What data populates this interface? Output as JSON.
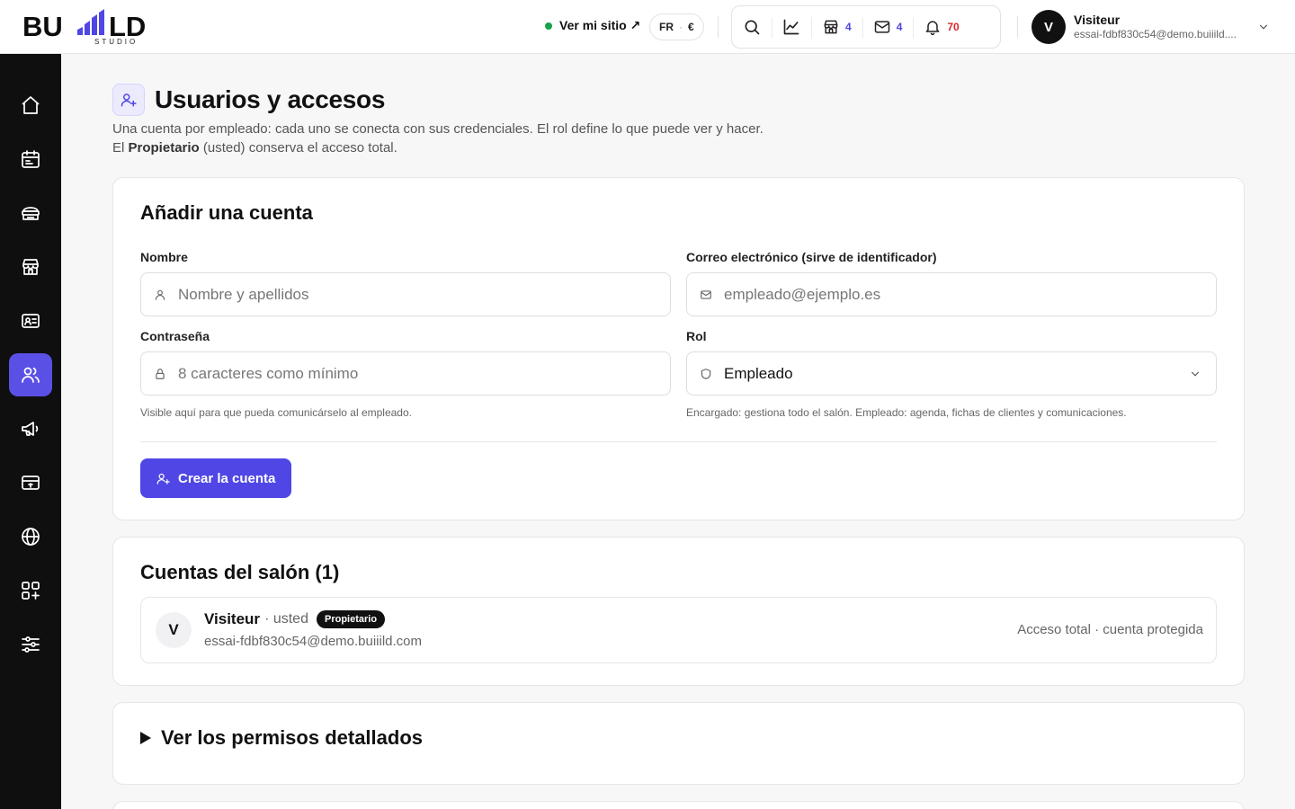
{
  "header": {
    "logo_text": "BUILD",
    "logo_sub": "STUDIO",
    "site_link": "Ver mi sitio ↗",
    "lang": "FR",
    "currency": "€",
    "badges": {
      "store": "4",
      "mail": "4",
      "bell": "70"
    },
    "user": {
      "initial": "V",
      "name": "Visiteur",
      "email": "essai-fdbf830c54@demo.buiiild...."
    }
  },
  "sidebar": {
    "items": [
      {
        "icon": "home-icon"
      },
      {
        "icon": "calendar-icon"
      },
      {
        "icon": "services-icon"
      },
      {
        "icon": "store-icon"
      },
      {
        "icon": "id-card-icon"
      },
      {
        "icon": "users-icon",
        "active": true
      },
      {
        "icon": "megaphone-icon"
      },
      {
        "icon": "payment-icon"
      },
      {
        "icon": "globe-icon"
      },
      {
        "icon": "apps-icon"
      },
      {
        "icon": "sliders-icon"
      }
    ]
  },
  "page": {
    "title": "Usuarios y accesos",
    "desc_part1": "Una cuenta por empleado: cada uno se conecta con sus credenciales. El rol define lo que puede ver y hacer. El ",
    "desc_bold": "Propietario",
    "desc_part2": " (usted) conserva el acceso total."
  },
  "add_account": {
    "title": "Añadir una cuenta",
    "name_label": "Nombre",
    "name_placeholder": "Nombre y apellidos",
    "email_label": "Correo electrónico (sirve de identificador)",
    "email_placeholder": "empleado@ejemplo.es",
    "password_label": "Contraseña",
    "password_placeholder": "8 caracteres como mínimo",
    "password_hint": "Visible aquí para que pueda comunicárselo al empleado.",
    "role_label": "Rol",
    "role_value": "Empleado",
    "role_hint": "Encargado: gestiona todo el salón. Empleado: agenda, fichas de clientes y comunicaciones.",
    "submit_label": "Crear la cuenta"
  },
  "accounts": {
    "title": "Cuentas del salón (1)",
    "rows": [
      {
        "initial": "V",
        "name": "Visiteur",
        "you": "· usted",
        "role": "Propietario",
        "email": "essai-fdbf830c54@demo.buiiild.com",
        "access": "Acceso total · cuenta protegida"
      }
    ]
  },
  "permissions": {
    "title": "Ver los permisos detallados"
  },
  "colors": {
    "accent": "#4f46e5",
    "sidebar_bg": "#0f0f10",
    "online": "#16a34a",
    "alert": "#dc2626"
  }
}
